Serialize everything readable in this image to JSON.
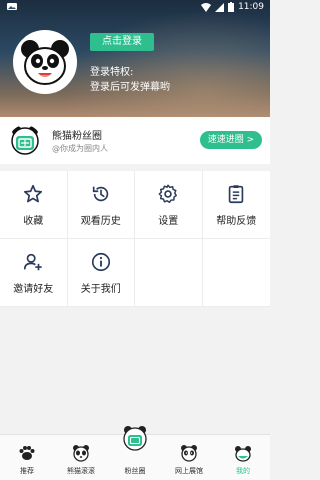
{
  "status_bar": {
    "time": "11:09"
  },
  "header": {
    "login_button": "点击登录",
    "perk_title": "登录特权:",
    "perk_desc": "登录后可发弹幕哟"
  },
  "fan_club": {
    "title": "熊猫粉丝圈",
    "subtitle": "@你成为圈内人",
    "join_button": "速速进圈 >"
  },
  "menu": [
    {
      "label": "收藏",
      "icon": "star-icon"
    },
    {
      "label": "观看历史",
      "icon": "history-icon"
    },
    {
      "label": "设置",
      "icon": "gear-icon"
    },
    {
      "label": "帮助反馈",
      "icon": "clipboard-icon"
    },
    {
      "label": "邀请好友",
      "icon": "add-user-icon"
    },
    {
      "label": "关于我们",
      "icon": "info-icon"
    }
  ],
  "tabs": [
    {
      "label": "推荐",
      "icon": "paw-icon"
    },
    {
      "label": "熊猫滚滚",
      "icon": "panda-icon"
    },
    {
      "label": "粉丝圈",
      "icon": "fan-club-icon"
    },
    {
      "label": "网上展馆",
      "icon": "panda-museum-icon"
    },
    {
      "label": "我的",
      "icon": "panda-me-icon"
    }
  ],
  "colors": {
    "accent": "#2fbf8f",
    "header_top": "#1c2d40"
  }
}
